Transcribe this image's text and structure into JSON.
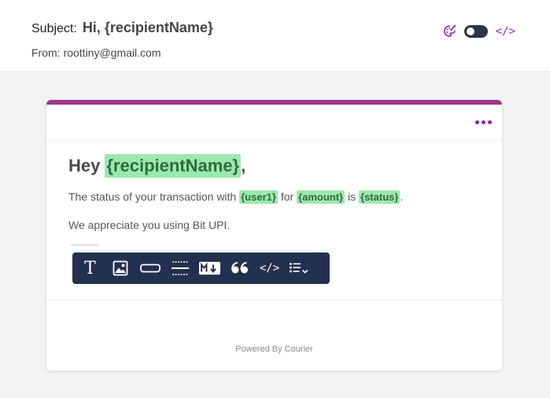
{
  "header": {
    "subject_label": "Subject:",
    "subject_value": "Hi, {recipientName}",
    "from_label": "From:",
    "from_value": "roottiny@gmail.com",
    "code_label": "</>"
  },
  "template": {
    "greeting_prefix": "Hey",
    "greeting_var": "{recipientName}",
    "greeting_suffix": ",",
    "para1_text1": "The status of your transaction with",
    "para1_var1": "{user1}",
    "para1_text2": "for",
    "para1_var2": "{amount}",
    "para1_text3": "is",
    "para1_var3": "{status}",
    "para1_text4": ".",
    "para2": "We appreciate you using Bit UPI."
  },
  "toolbar": {
    "text_label": "T",
    "code_label": "</>",
    "icons": [
      "text-icon",
      "image-icon",
      "button-icon",
      "divider-icon",
      "markdown-icon",
      "quote-icon",
      "code-icon",
      "list-icon"
    ]
  },
  "footer": {
    "powered_by": "Powered By Courier"
  },
  "colors": {
    "accent": "#9121c2",
    "card_top": "#9d3789",
    "toolbar_bg": "#23304f",
    "variable_bg": "#9de8b0"
  }
}
